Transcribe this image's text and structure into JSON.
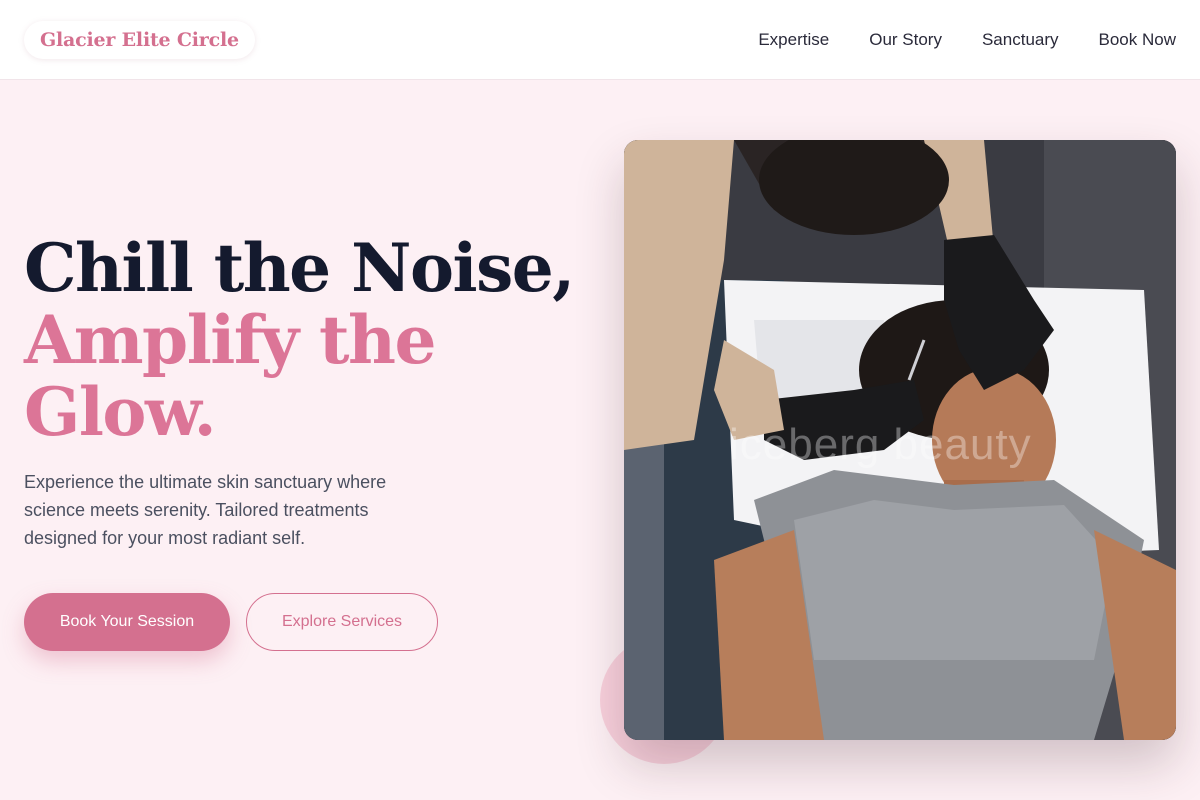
{
  "header": {
    "logo": "Glacier Elite Circle",
    "nav": [
      "Expertise",
      "Our Story",
      "Sanctuary",
      "Book Now"
    ]
  },
  "hero": {
    "headline_line1": "Chill the Noise,",
    "headline_line2": "Amplify the",
    "headline_line3": "Glow.",
    "description": "Experience the ultimate skin sanctuary where science meets serenity. Tailored treatments designed for your most radiant self.",
    "primary_cta": "Book Your Session",
    "secondary_cta": "Explore Services",
    "image_watermark": "iceberg beauty"
  },
  "colors": {
    "accent": "#d4708f",
    "headline_dark": "#141a2e",
    "background": "#fdf0f4"
  }
}
